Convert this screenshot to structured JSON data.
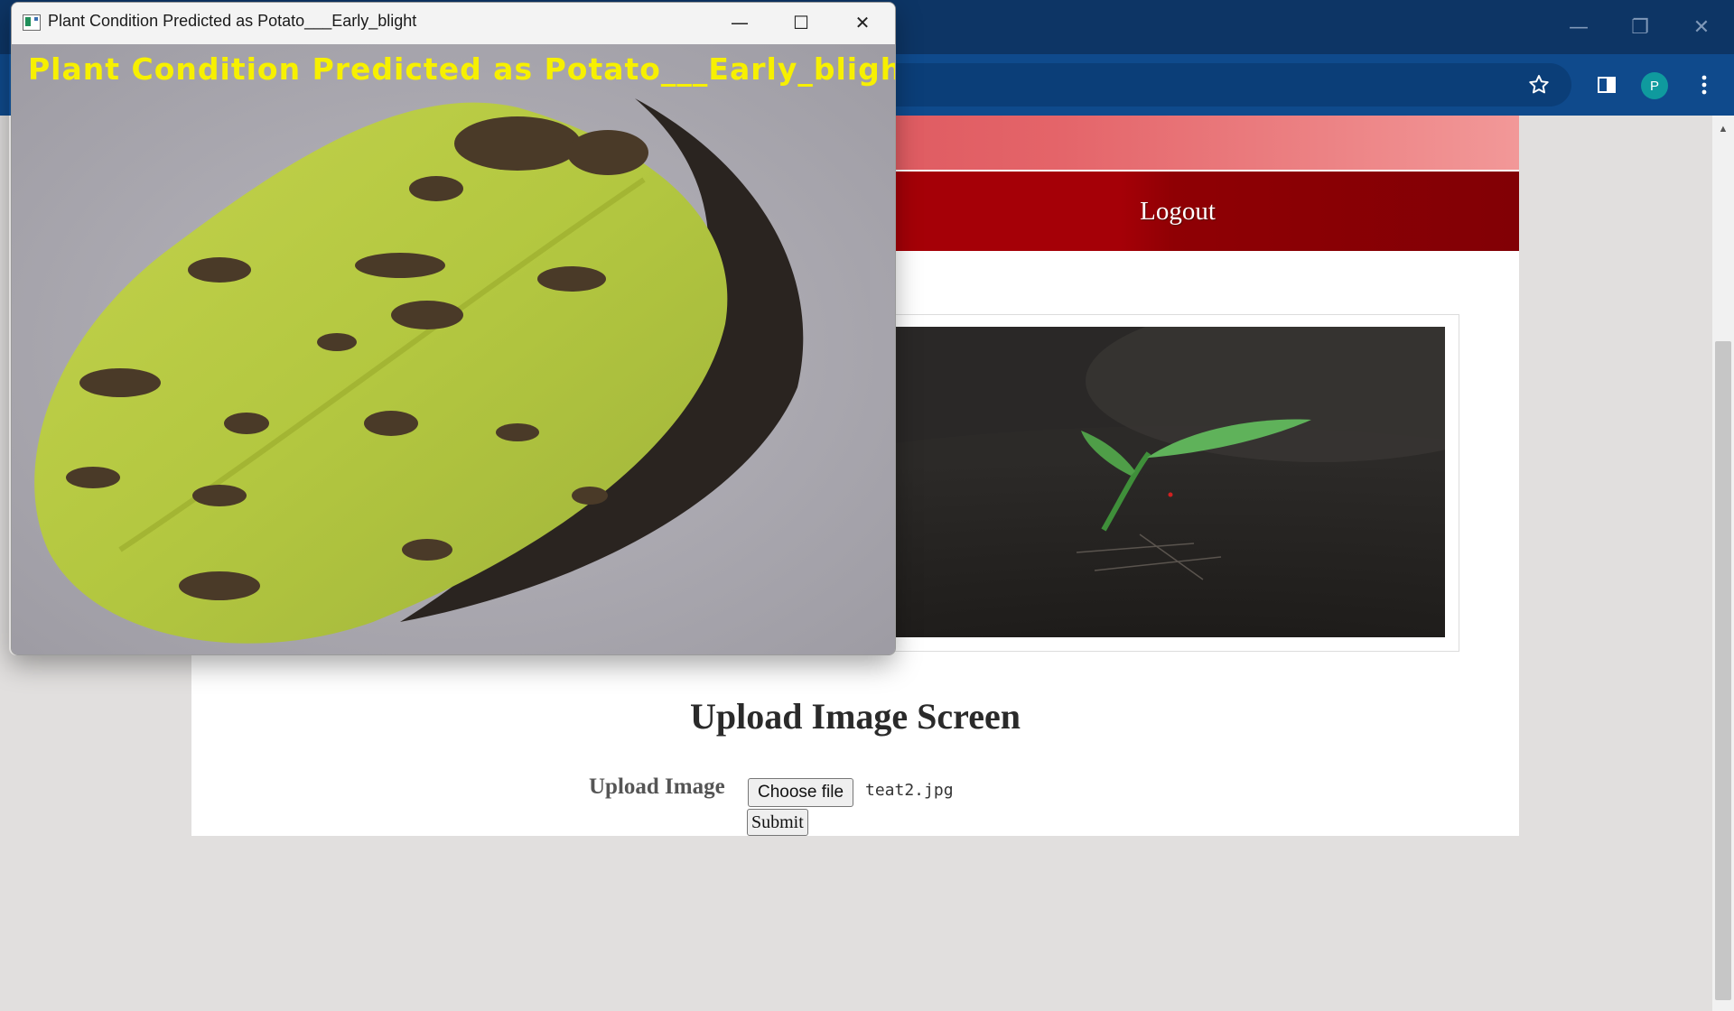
{
  "browser": {
    "window_controls": {
      "minimize": "—",
      "restore": "❐",
      "close": "✕"
    },
    "toolbar_icons": [
      "star-icon",
      "side-panel-icon",
      "profile-avatar",
      "kebab-menu-icon"
    ],
    "profile_initial": "P",
    "colors": {
      "titlebar": "#0d3565",
      "toolbar": "#0f4a8c",
      "avatar": "#0f9a9e"
    }
  },
  "page": {
    "nav": {
      "logout_label": "Logout"
    },
    "heading": "Upload Image Screen",
    "form": {
      "upload_label": "Upload Image",
      "choose_file_label": "Choose file",
      "selected_file": "teat2.jpg",
      "submit_label": "Submit"
    },
    "colors": {
      "banner": "#de5a60",
      "nav": "#a50007"
    }
  },
  "popup": {
    "title": "Plant Condition Predicted as Potato___Early_blight",
    "overlay_text": "Plant Condition Predicted as Potato___Early_blight",
    "controls": {
      "minimize": "—",
      "maximize": "☐",
      "close": "✕"
    },
    "colors": {
      "overlay_text": "#f7f000"
    }
  }
}
